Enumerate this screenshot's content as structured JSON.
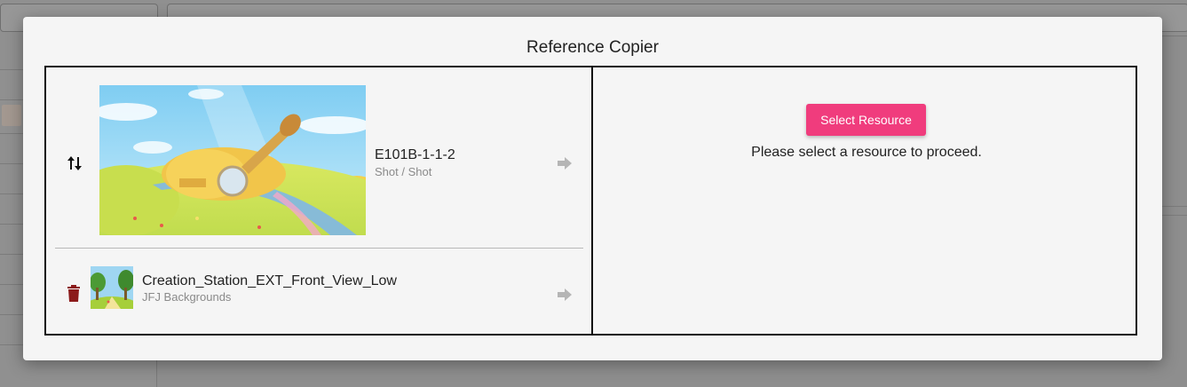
{
  "modal": {
    "title": "Reference Copier"
  },
  "source": {
    "shot": {
      "name": "E101B-1-1-2",
      "type": "Shot / Shot"
    },
    "asset": {
      "name": "Creation_Station_EXT_Front_View_Low",
      "type": "JFJ Backgrounds"
    }
  },
  "target": {
    "select_button_label": "Select Resource",
    "message": "Please select a resource to proceed."
  },
  "colors": {
    "accent": "#f03c7d",
    "trash": "#8b1a1a",
    "arrow": "#b5b5b5"
  }
}
